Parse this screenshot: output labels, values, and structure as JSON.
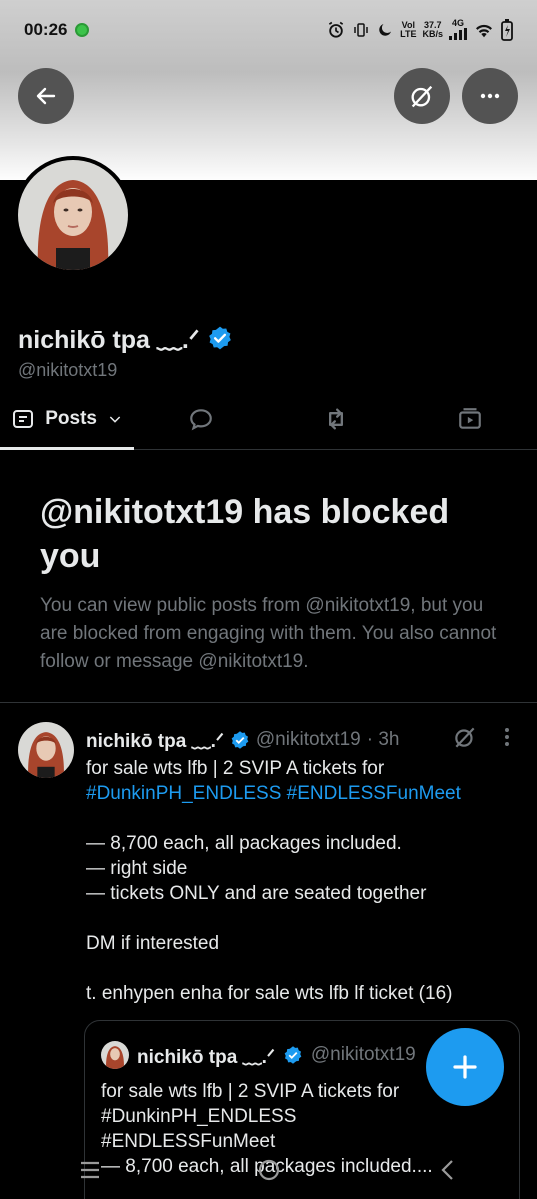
{
  "status_bar": {
    "time": "00:26",
    "net_top": "Vol",
    "net_bottom": "LTE",
    "speed_top": "37.7",
    "speed_bottom": "KB/s",
    "network_type": "4G"
  },
  "profile": {
    "display_name": "nichikō tpa ﹏.ᐟ",
    "handle": "@nikitotxt19",
    "verified": true
  },
  "tabs": [
    {
      "label": "Posts",
      "icon": "posts-icon",
      "active": true
    },
    {
      "label": "",
      "icon": "reply-icon",
      "active": false
    },
    {
      "label": "",
      "icon": "repost-icon",
      "active": false
    },
    {
      "label": "",
      "icon": "media-icon",
      "active": false
    }
  ],
  "blocked": {
    "title": "@nikitotxt19 has blocked you",
    "description": "You can view public posts from @nikitotxt19, but you are blocked from engaging with them. You also cannot follow or message @nikitotxt19."
  },
  "post": {
    "author_name": "nichikō tpa ﹏.ᐟ",
    "author_handle": "@nikitotxt19",
    "time": "· 3h",
    "lines": [
      "for sale wts lfb | 2 SVIP A tickets for",
      "",
      "",
      "— 8,700 each, all packages included.",
      "— right side",
      "— tickets ONLY and are seated together",
      "",
      "DM if interested",
      "",
      "t. enhypen enha for sale wts lfb lf ticket (16)"
    ],
    "hashtag_line": [
      "#DunkinPH_ENDLESS",
      "#ENDLESSFunMeet"
    ]
  },
  "quote": {
    "author_name": "nichikō tpa ﹏.ᐟ",
    "author_handle": "@nikitotxt19",
    "lines": [
      "for sale wts lfb | 2 SVIP A tickets for",
      "#DunkinPH_ENDLESS",
      "#ENDLESSFunMeet",
      "",
      "— 8,700 each, all packages included...."
    ]
  },
  "colors": {
    "accent": "#1d9bf0",
    "muted": "#71767b",
    "text": "#e7e9ea",
    "background": "#000000"
  }
}
